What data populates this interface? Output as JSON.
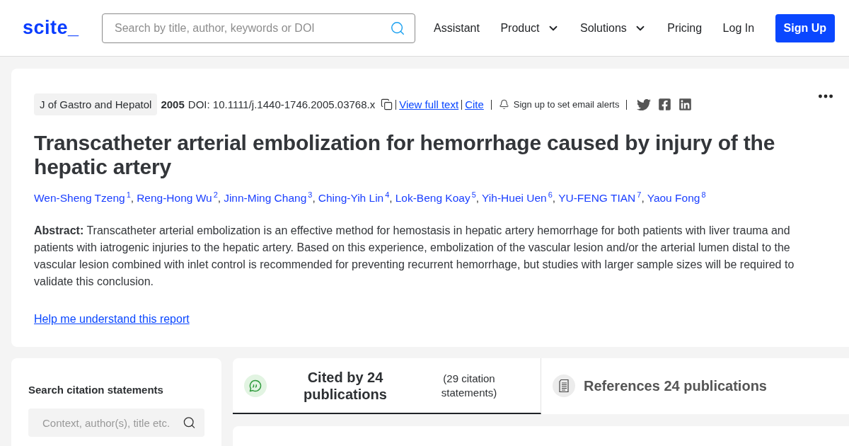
{
  "header": {
    "logo": "scite_",
    "search": {
      "placeholder": "Search by title, author, keywords or DOI"
    },
    "nav": [
      {
        "label": "Assistant",
        "kind": "link"
      },
      {
        "label": "Product",
        "kind": "dropdown"
      },
      {
        "label": "Solutions",
        "kind": "dropdown"
      },
      {
        "label": "Pricing",
        "kind": "link"
      },
      {
        "label": "Log In",
        "kind": "link"
      },
      {
        "label": "Sign Up",
        "kind": "button"
      }
    ]
  },
  "article": {
    "journal": "J of Gastro and Hepatol",
    "year": "2005",
    "doi": "DOI: 10.1111/j.1440-1746.2005.03768.x",
    "links": [
      "View full text",
      "Cite"
    ],
    "alerts": "Sign up to set email alerts",
    "title": "Transcatheter arterial embolization for hemorrhage caused by injury of the hepatic artery",
    "authors": [
      {
        "name": "Wen-Sheng Tzeng",
        "affiliation": "1",
        "separator": ","
      },
      {
        "name": "Reng-Hong Wu",
        "affiliation": "2",
        "separator": ","
      },
      {
        "name": "Jinn-Ming Chang",
        "affiliation": "3",
        "separator": ","
      },
      {
        "name": "Ching-Yih Lin",
        "affiliation": "4",
        "separator": ","
      },
      {
        "name": "Lok-Beng Koay",
        "affiliation": "5",
        "separator": ","
      },
      {
        "name": "Yih-Huei Uen",
        "affiliation": "6",
        "separator": ","
      },
      {
        "name": "YU-FENG TIAN",
        "affiliation": "7",
        "separator": ","
      },
      {
        "name": "Yaou Fong",
        "affiliation": "8"
      }
    ],
    "abstract": "**Abstract:** Transcatheter arterial embolization is an effective method for hemostasis in hepatic artery hemorrhage for both patients with liver trauma and patients with iatrogenic injuries to the hepatic artery. Based on this experience, embolization of the vascular lesion and/or the arterial lumen distal to the vascular lesion combined with inlet control is recommended for preventing recurrent hemorrhage, but studies with larger sample sizes will be required to validate this conclusion.",
    "help_link": "Help me understand this report"
  },
  "citation_search": {
    "title": "Search citation statements",
    "placeholder": "Context, author(s), title etc."
  },
  "tabs": [
    {
      "kind": "cited",
      "label": "Cited by 24 publications",
      "note": "(29 citation statements)",
      "selected": true
    },
    {
      "kind": "references",
      "label": "References 24 publications",
      "selected": false
    }
  ]
}
